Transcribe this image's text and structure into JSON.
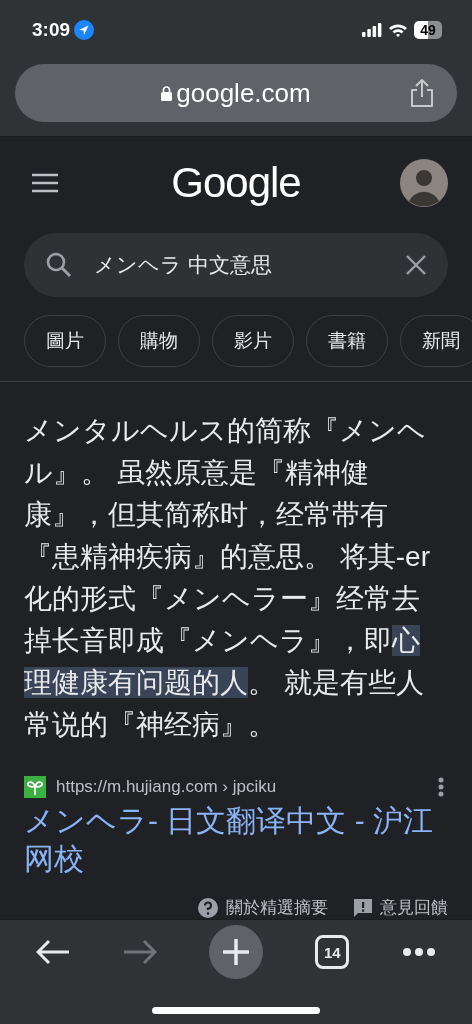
{
  "status_bar": {
    "time": "3:09",
    "battery": "49"
  },
  "address_bar": {
    "url": "google.com"
  },
  "header": {
    "logo": "Google"
  },
  "search": {
    "value": "メンヘラ 中文意思"
  },
  "chips": [
    {
      "label": "圖片"
    },
    {
      "label": "購物"
    },
    {
      "label": "影片"
    },
    {
      "label": "書籍"
    },
    {
      "label": "新聞"
    }
  ],
  "snippet": {
    "segments": [
      {
        "text": "メンタルヘルス的简称『メンヘル』。 虽然原意是『精神健康』，但其简称时，经常带有『患精神疾病』的意思。 将其-er化的形式『メンヘラー』经常去掉长音即成『メンヘラ』，即",
        "highlighted": false
      },
      {
        "text": "心理健康有问题的人",
        "highlighted": true
      },
      {
        "text": "。 就是有些人常说的『神经病』。",
        "highlighted": false
      }
    ]
  },
  "source": {
    "url": "https://m.hujiang.com",
    "path": "› jpciku",
    "title": "メンヘラ- 日文翻译中文 - 沪江网校"
  },
  "footer_links": [
    "關於精選摘要",
    "意見回饋"
  ],
  "toolbar": {
    "back_disabled": false,
    "forward_disabled": true,
    "tab_count": "14"
  }
}
